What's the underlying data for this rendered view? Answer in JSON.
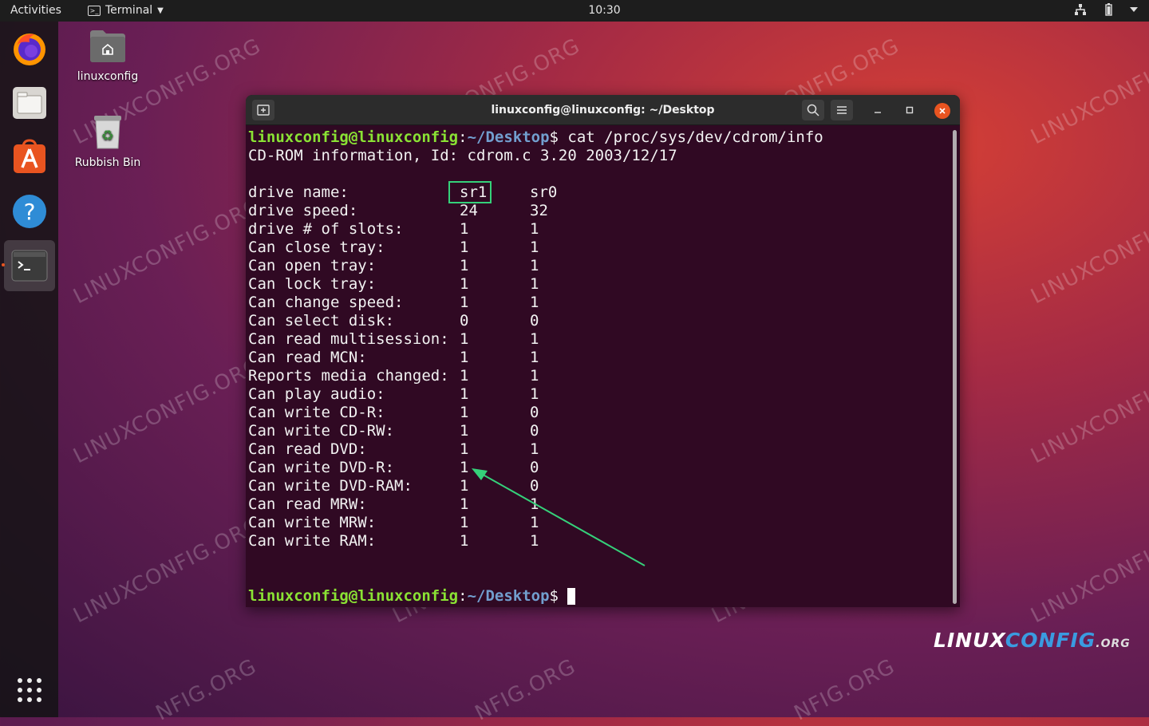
{
  "topbar": {
    "activities": "Activities",
    "app_name": "Terminal",
    "clock": "10:30"
  },
  "desktop": {
    "home_folder_label": "linuxconfig",
    "trash_label": "Rubbish Bin"
  },
  "watermark": "LINUXCONFIG.ORG",
  "watermark_fragment": "NFIG.ORG",
  "brand": {
    "part1": "LINUX",
    "part2": "CONFIG",
    "part3": ".ORG"
  },
  "terminal": {
    "title": "linuxconfig@linuxconfig: ~/Desktop",
    "prompt_user": "linuxconfig@linuxconfig",
    "prompt_sep": ":",
    "prompt_path": "~/Desktop",
    "prompt_end": "$",
    "command": " cat /proc/sys/dev/cdrom/info",
    "info_header": "CD-ROM information, Id: cdrom.c 3.20 2003/12/17",
    "rows": [
      {
        "label": "drive name:",
        "v1": "sr1",
        "v2": "sr0"
      },
      {
        "label": "drive speed:",
        "v1": "24",
        "v2": "32"
      },
      {
        "label": "drive # of slots:",
        "v1": "1",
        "v2": "1"
      },
      {
        "label": "Can close tray:",
        "v1": "1",
        "v2": "1"
      },
      {
        "label": "Can open tray:",
        "v1": "1",
        "v2": "1"
      },
      {
        "label": "Can lock tray:",
        "v1": "1",
        "v2": "1"
      },
      {
        "label": "Can change speed:",
        "v1": "1",
        "v2": "1"
      },
      {
        "label": "Can select disk:",
        "v1": "0",
        "v2": "0"
      },
      {
        "label": "Can read multisession:",
        "v1": "1",
        "v2": "1"
      },
      {
        "label": "Can read MCN:",
        "v1": "1",
        "v2": "1"
      },
      {
        "label": "Reports media changed:",
        "v1": "1",
        "v2": "1"
      },
      {
        "label": "Can play audio:",
        "v1": "1",
        "v2": "1"
      },
      {
        "label": "Can write CD-R:",
        "v1": "1",
        "v2": "0"
      },
      {
        "label": "Can write CD-RW:",
        "v1": "1",
        "v2": "0"
      },
      {
        "label": "Can read DVD:",
        "v1": "1",
        "v2": "1"
      },
      {
        "label": "Can write DVD-R:",
        "v1": "1",
        "v2": "0"
      },
      {
        "label": "Can write DVD-RAM:",
        "v1": "1",
        "v2": "0"
      },
      {
        "label": "Can read MRW:",
        "v1": "1",
        "v2": "1"
      },
      {
        "label": "Can write MRW:",
        "v1": "1",
        "v2": "1"
      },
      {
        "label": "Can write RAM:",
        "v1": "1",
        "v2": "1"
      }
    ]
  },
  "colors": {
    "accent": "#e95420",
    "prompt_user": "#8ae234",
    "prompt_path": "#729fcf",
    "highlight": "#35d17a"
  },
  "icons": [
    "firefox-icon",
    "files-icon",
    "software-icon",
    "help-icon",
    "terminal-icon",
    "app-grid-icon",
    "network-icon",
    "battery-icon",
    "system-menu-icon"
  ]
}
